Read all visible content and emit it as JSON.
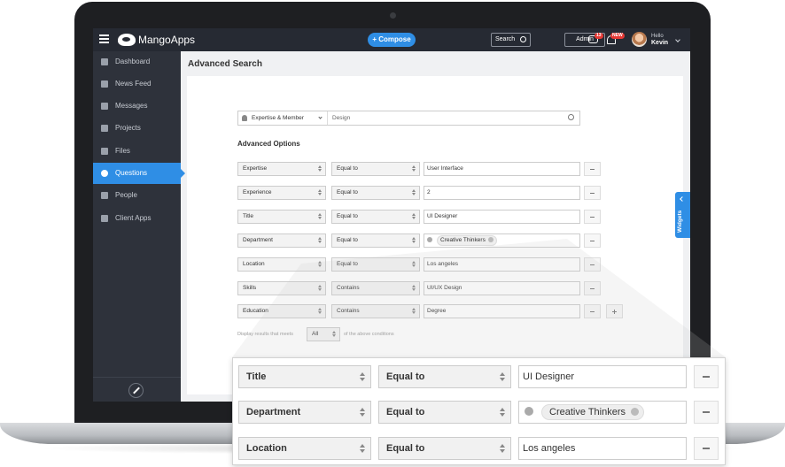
{
  "topbar": {
    "brand": "MangoApps",
    "compose_label": "Compose",
    "search_label": "Search",
    "admin_label": "Admin",
    "chat_badge": "13",
    "bell_badge": "NEW",
    "greeting": "Hello",
    "user_name": "Kevin"
  },
  "sidebar": {
    "items": [
      {
        "label": "Dashboard",
        "icon": "home-icon"
      },
      {
        "label": "News Feed",
        "icon": "inbox-icon"
      },
      {
        "label": "Messages",
        "icon": "envelope-icon"
      },
      {
        "label": "Projects",
        "icon": "briefcase-icon"
      },
      {
        "label": "Files",
        "icon": "file-icon"
      },
      {
        "label": "Questions",
        "icon": "question-icon",
        "active": true
      },
      {
        "label": "People",
        "icon": "person-icon"
      },
      {
        "label": "Client Apps",
        "icon": "download-icon"
      }
    ]
  },
  "page": {
    "title": "Advanced Search"
  },
  "search": {
    "scope": "Expertise & Member",
    "placeholder": "Design"
  },
  "advanced": {
    "title": "Advanced Options",
    "rows": [
      {
        "field": "Expertise",
        "operator": "Equal to",
        "value": "User Interface"
      },
      {
        "field": "Experience",
        "operator": "Equal to",
        "value": "2"
      },
      {
        "field": "Title",
        "operator": "Equal to",
        "value": "UI Designer"
      },
      {
        "field": "Department",
        "operator": "Equal to",
        "value": "Creative Thinkers"
      },
      {
        "field": "Location",
        "operator": "Equal to",
        "value": "Los angeles"
      },
      {
        "field": "Skills",
        "operator": "Contains",
        "value": "UI/UX Design"
      },
      {
        "field": "Education",
        "operator": "Contains",
        "value": "Degree"
      }
    ],
    "display_prefix": "Display results that meets",
    "display_value": "All",
    "display_suffix": "of the above conditions"
  },
  "widgets_label": "Widgets",
  "zoom": {
    "rows": [
      {
        "field": "Title",
        "operator": "Equal to",
        "value": "UI Designer"
      },
      {
        "field": "Department",
        "operator": "Equal to",
        "value": "Creative Thinkers"
      },
      {
        "field": "Location",
        "operator": "Equal to",
        "value": "Los angeles"
      }
    ]
  },
  "colors": {
    "accent": "#2f8ee5",
    "topbar": "#262a33",
    "sidebar": "#2e323b"
  }
}
